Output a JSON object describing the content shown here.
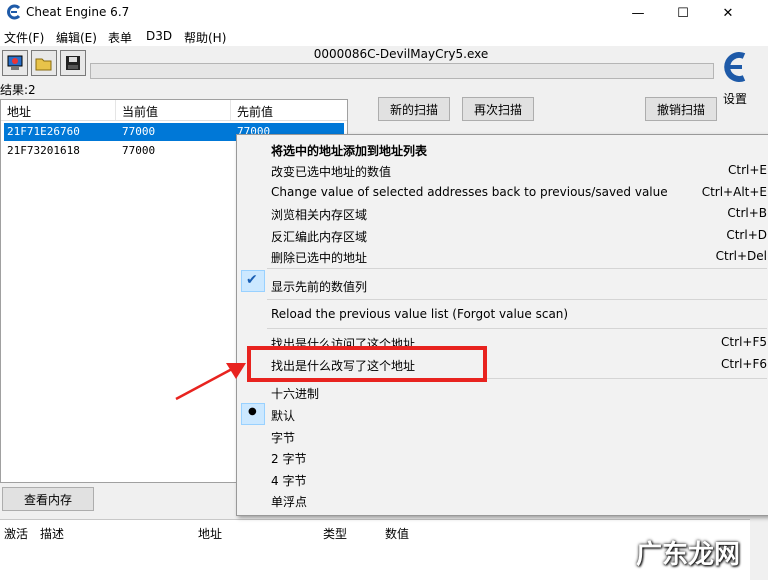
{
  "window": {
    "title": "Cheat Engine 6.7",
    "minimize": "—",
    "maximize": "☐",
    "close": "✕"
  },
  "menu": [
    "文件(F)",
    "编辑(E)",
    "表单",
    "D3D",
    "帮助(H)"
  ],
  "process": "0000086C-DevilMayCry5.exe",
  "settings_label": "设置",
  "results_label": "结果:2",
  "list": {
    "headers": [
      "地址",
      "当前值",
      "先前值"
    ],
    "rows": [
      {
        "address": "21F71E26760",
        "current": "77000",
        "previous": "77000",
        "selected": true
      },
      {
        "address": "21F73201618",
        "current": "77000",
        "previous": "",
        "selected": false
      }
    ]
  },
  "buttons": {
    "new_scan": "新的扫描",
    "next_scan": "再次扫描",
    "undo_scan": "撤销扫描",
    "view_memory": "查看内存"
  },
  "bottom_headers": [
    "激活",
    "描述",
    "地址",
    "类型",
    "数值"
  ],
  "context_menu": {
    "items": [
      {
        "label": "将选中的地址添加到地址列表",
        "shortcut": "",
        "bold": true
      },
      {
        "label": "改变已选中地址的数值",
        "shortcut": "Ctrl+E"
      },
      {
        "label": "Change value of selected addresses back to previous/saved value",
        "shortcut": "Ctrl+Alt+E"
      },
      {
        "label": "浏览相关内存区域",
        "shortcut": "Ctrl+B"
      },
      {
        "label": "反汇编此内存区域",
        "shortcut": "Ctrl+D"
      },
      {
        "label": "删除已选中的地址",
        "shortcut": "Ctrl+Del"
      },
      {
        "label": "显示先前的数值列",
        "shortcut": ""
      },
      {
        "label": "Reload the previous value list (Forgot value scan)",
        "shortcut": ""
      },
      {
        "label": "找出是什么访问了这个地址",
        "shortcut": "Ctrl+F5"
      },
      {
        "label": "找出是什么改写了这个地址",
        "shortcut": "Ctrl+F6"
      },
      {
        "label": "十六进制",
        "shortcut": ""
      },
      {
        "label": "默认",
        "shortcut": ""
      },
      {
        "label": "字节",
        "shortcut": ""
      },
      {
        "label": "2 字节",
        "shortcut": ""
      },
      {
        "label": "4 字节",
        "shortcut": ""
      },
      {
        "label": "单浮点",
        "shortcut": ""
      }
    ],
    "check_mark": "✔",
    "radio_dot": "●"
  },
  "watermark": "广东龙网",
  "colors": {
    "selection": "#0078d7",
    "highlight_box": "#e8231f",
    "arrow": "#e8231f"
  }
}
